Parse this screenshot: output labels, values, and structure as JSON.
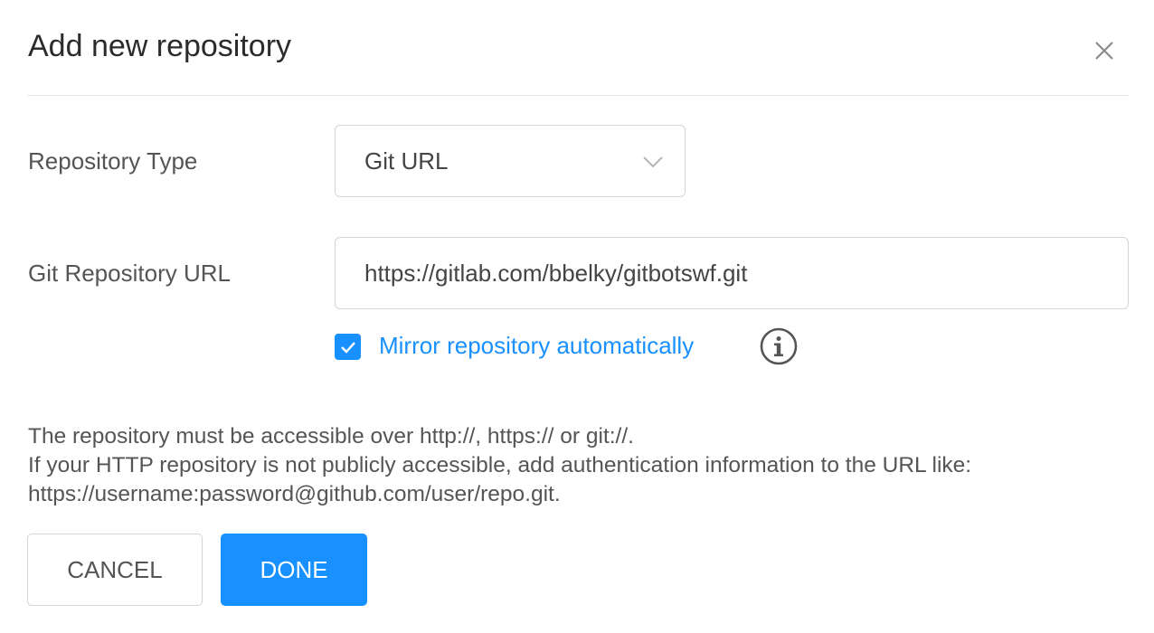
{
  "dialog": {
    "title": "Add new repository",
    "close_icon": "close-icon"
  },
  "form": {
    "repository_type": {
      "label": "Repository Type",
      "selected": "Git URL",
      "icon": "chevron-down-icon"
    },
    "git_url": {
      "label": "Git Repository URL",
      "value": "https://gitlab.com/bbelky/gitbotswf.git"
    },
    "mirror": {
      "checked": true,
      "label": "Mirror repository automatically",
      "info_icon": "info-icon"
    }
  },
  "help_text": {
    "line1": "The repository must be accessible over http://, https:// or git://.",
    "line2": "If your HTTP repository is not publicly accessible, add authentication information to the URL like:",
    "line3": "https://username:password@github.com/user/repo.git."
  },
  "buttons": {
    "cancel": "CANCEL",
    "done": "DONE"
  },
  "colors": {
    "accent": "#1890ff",
    "text": "#555555",
    "border": "#d4d4d4"
  }
}
